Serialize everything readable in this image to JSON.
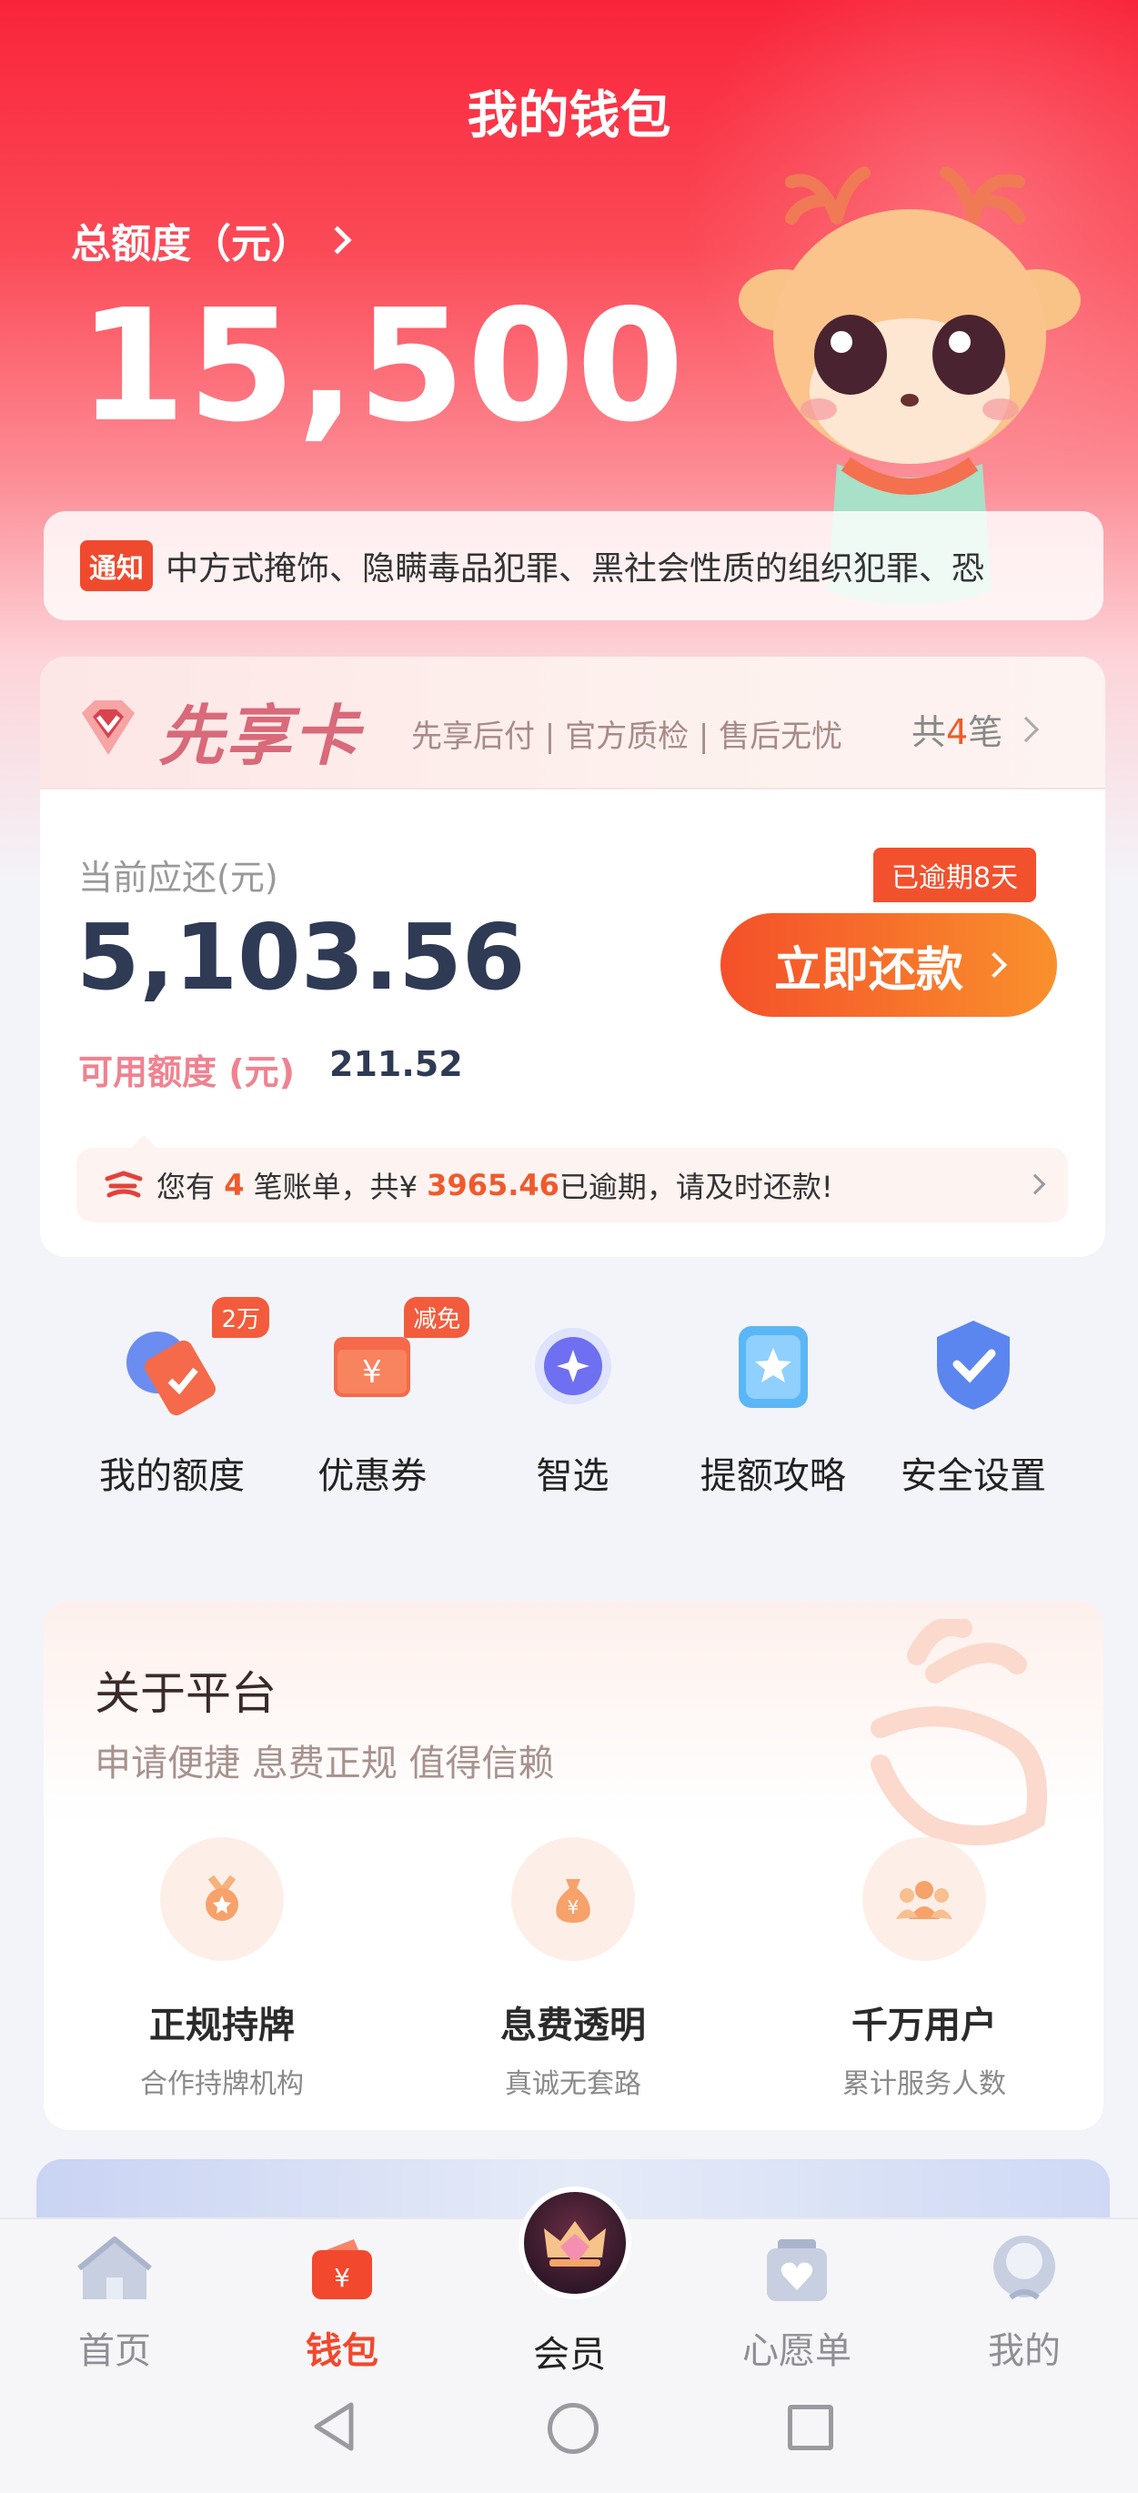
{
  "header": {
    "title": "我的钱包"
  },
  "credit": {
    "label": "总额度（元）",
    "amount": "15,500"
  },
  "notice": {
    "badge": "通知",
    "text": "中方式掩饰、隐瞒毒品犯罪、黑社会性质的组织犯罪、恐"
  },
  "card": {
    "brand": "先享卡",
    "slogan": "先享后付 | 官方质检 | 售后无忧",
    "count_prefix": "共",
    "count_num": "4",
    "count_suffix": "笔",
    "due_label": "当前应还(元)",
    "due_amount": "5,103.56",
    "overdue_badge": "已逾期8天",
    "pay_button": "立即还款",
    "available_label": "可用额度 (元)",
    "available_value": "211.52",
    "bill": {
      "t1": "您有",
      "count": "4",
      "t2": "笔账单，共¥",
      "amount": "3965.46",
      "t3": "已逾期，请及时还款!"
    }
  },
  "quick_actions": [
    {
      "label": "我的额度",
      "tag": "2万",
      "icon": "credit-limit-icon"
    },
    {
      "label": "优惠券",
      "tag": "减免",
      "icon": "coupon-icon"
    },
    {
      "label": "智选",
      "tag": "",
      "icon": "smart-select-icon"
    },
    {
      "label": "提额攻略",
      "tag": "",
      "icon": "raise-limit-icon"
    },
    {
      "label": "安全设置",
      "tag": "",
      "icon": "security-shield-icon"
    }
  ],
  "about": {
    "title": "关于平台",
    "subtitle": "申请便捷 息费正规 值得信赖",
    "features": [
      {
        "title": "正规持牌",
        "desc": "合作持牌机构",
        "icon": "license-medal-icon"
      },
      {
        "title": "息费透明",
        "desc": "真诚无套路",
        "icon": "money-bag-icon"
      },
      {
        "title": "千万用户",
        "desc": "累计服务人数",
        "icon": "users-icon"
      }
    ]
  },
  "tabbar": [
    {
      "label": "首页",
      "icon": "home-icon",
      "active": false
    },
    {
      "label": "钱包",
      "icon": "wallet-icon",
      "active": true
    },
    {
      "label": "会员",
      "icon": "member-crown-icon",
      "active": false
    },
    {
      "label": "心愿单",
      "icon": "wishlist-heart-icon",
      "active": false
    },
    {
      "label": "我的",
      "icon": "profile-icon",
      "active": false
    }
  ],
  "colors": {
    "accent": "#f2482e",
    "hero": "#f9243a",
    "amount_text": "#2f3a55"
  }
}
